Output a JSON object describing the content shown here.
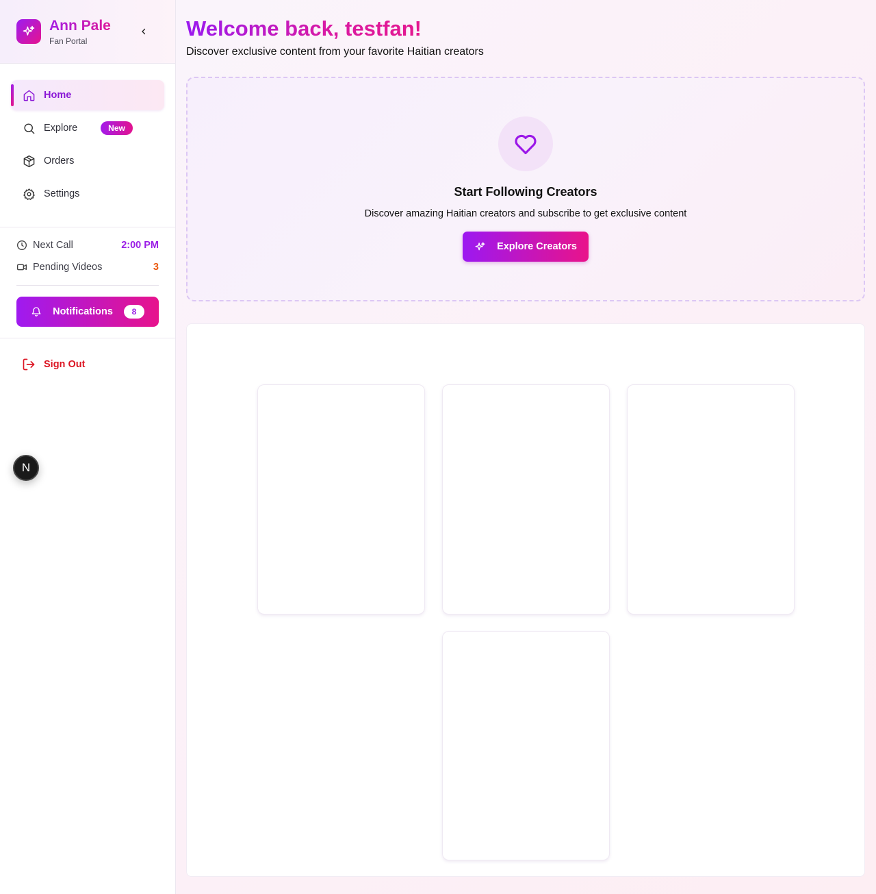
{
  "brand": {
    "name": "Ann Pale",
    "subtitle": "Fan Portal"
  },
  "nav": {
    "items": [
      {
        "label": "Home",
        "icon": "home-icon",
        "active": true
      },
      {
        "label": "Explore",
        "icon": "search-icon",
        "badge": "New"
      },
      {
        "label": "Orders",
        "icon": "package-icon"
      },
      {
        "label": "Settings",
        "icon": "gear-icon"
      }
    ]
  },
  "stats": {
    "next_call": {
      "label": "Next Call",
      "value": "2:00 PM",
      "color": "#9b1ee6"
    },
    "pending_videos": {
      "label": "Pending Videos",
      "value": "3",
      "color": "#ea580c"
    }
  },
  "notifications": {
    "label": "Notifications",
    "count": "8"
  },
  "sign_out": {
    "label": "Sign Out",
    "color": "#dc1523"
  },
  "dev_badge": {
    "label": "N"
  },
  "main": {
    "welcome": "Welcome back, testfan!",
    "subtitle": "Discover exclusive content from your favorite Haitian creators",
    "empty_state": {
      "icon": "heart-icon",
      "title": "Start Following Creators",
      "description": "Discover amazing Haitian creators and subscribe to get exclusive content",
      "button_label": "Explore Creators",
      "button_icon": "sparkles-icon"
    },
    "skeleton_cards": 4
  },
  "colors": {
    "accent_purple": "#9b1ee6",
    "accent_pink": "#e6138e"
  }
}
